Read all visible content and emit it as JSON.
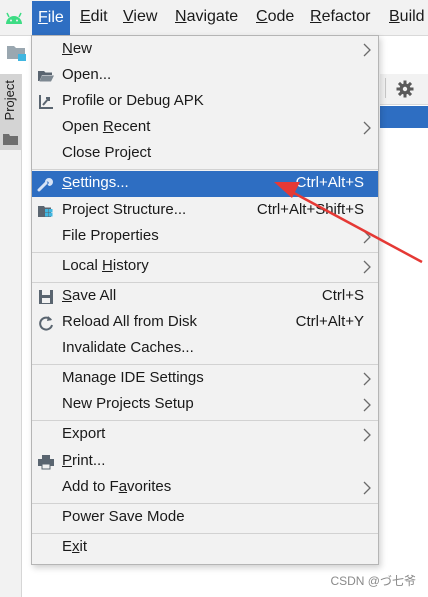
{
  "menubar": {
    "items": [
      {
        "label": "File",
        "mnemonic": "F",
        "rest": "ile",
        "active": true
      },
      {
        "label": "Edit",
        "mnemonic": "E",
        "rest": "dit"
      },
      {
        "label": "View",
        "mnemonic": "V",
        "rest": "iew"
      },
      {
        "label": "Navigate",
        "mnemonic": "N",
        "rest": "avigate"
      },
      {
        "label": "Code",
        "mnemonic": "C",
        "rest": "ode"
      },
      {
        "label": "Refactor",
        "mnemonic": "R",
        "rest": "efactor"
      },
      {
        "label": "Build",
        "mnemonic": "B",
        "rest": "uild"
      }
    ]
  },
  "side_panel": {
    "tab_label": "Project"
  },
  "file_menu": {
    "items": [
      {
        "pre": "",
        "mn": "N",
        "post": "ew",
        "submenu": true
      },
      {
        "pre": "Open...",
        "mn": "",
        "post": "",
        "icon": "folder-open-icon"
      },
      {
        "pre": "Profile or Debug APK",
        "mn": "",
        "post": "",
        "icon": "profile-debug-apk-icon"
      },
      {
        "pre": "Open ",
        "mn": "R",
        "post": "ecent",
        "submenu": true
      },
      {
        "pre": "Close Project",
        "mn": "",
        "post": ""
      },
      {
        "pre": "",
        "mn": "S",
        "post": "ettings...",
        "shortcut": "Ctrl+Alt+S",
        "icon": "wrench-icon",
        "selected": true
      },
      {
        "pre": "Project Structure...",
        "mn": "",
        "post": "",
        "shortcut": "Ctrl+Alt+Shift+S",
        "icon": "project-structure-icon"
      },
      {
        "pre": "File Properties",
        "mn": "",
        "post": "",
        "submenu": true
      },
      {
        "pre": "Local ",
        "mn": "H",
        "post": "istory",
        "submenu": true
      },
      {
        "pre": "",
        "mn": "S",
        "post": "ave All",
        "shortcut": "Ctrl+S",
        "icon": "save-icon"
      },
      {
        "pre": "Reload All from Disk",
        "mn": "",
        "post": "",
        "shortcut": "Ctrl+Alt+Y",
        "icon": "reload-icon"
      },
      {
        "pre": "Invalidate Caches...",
        "mn": "",
        "post": ""
      },
      {
        "pre": "Manage IDE Settings",
        "mn": "",
        "post": "",
        "submenu": true
      },
      {
        "pre": "New Projects Setup",
        "mn": "",
        "post": "",
        "submenu": true
      },
      {
        "pre": "Export",
        "mn": "",
        "post": "",
        "submenu": true
      },
      {
        "pre": "",
        "mn": "P",
        "post": "rint...",
        "icon": "print-icon"
      },
      {
        "pre": "Add to F",
        "mn": "a",
        "post": "vorites",
        "submenu": true
      },
      {
        "pre": "Power Save Mode",
        "mn": "",
        "post": ""
      },
      {
        "pre": "E",
        "mn": "x",
        "post": "it"
      }
    ]
  },
  "annotation": {
    "color": "#e53935"
  },
  "watermark": "CSDN @づ七爷",
  "colors": {
    "selection": "#2e6ec2",
    "menu_bg": "#f2f2f2"
  }
}
